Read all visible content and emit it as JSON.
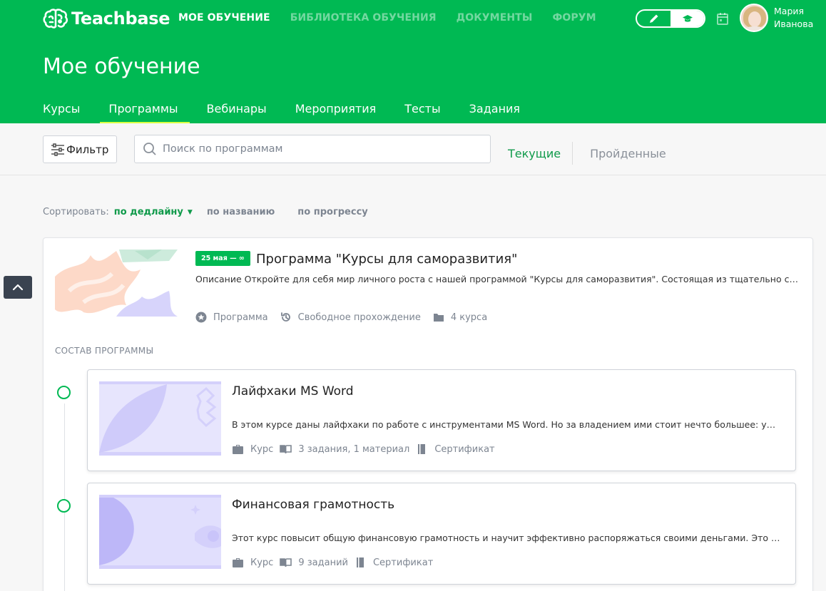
{
  "brand": {
    "name": "Teachbase",
    "accent": "#00b953",
    "highlight": "#d9ff43"
  },
  "topnav": [
    {
      "label": "МОЕ ОБУЧЕНИЕ",
      "active": true
    },
    {
      "label": "БИБЛИОТЕКА ОБУЧЕНИЯ",
      "active": false
    },
    {
      "label": "ДОКУМЕНТЫ",
      "active": false
    },
    {
      "label": "ФОРУМ",
      "active": false
    }
  ],
  "mode_toggle": {
    "icons": [
      "pencil-icon",
      "graduation-cap-icon"
    ],
    "active": "graduation-cap-icon"
  },
  "user": {
    "first_name": "Мария",
    "last_name": "Иванова"
  },
  "page_title": "Мое обучение",
  "subtabs": [
    {
      "label": "Курсы",
      "active": false
    },
    {
      "label": "Программы",
      "active": true
    },
    {
      "label": "Вебинары",
      "active": false
    },
    {
      "label": "Мероприятия",
      "active": false
    },
    {
      "label": "Тесты",
      "active": false
    },
    {
      "label": "Задания",
      "active": false
    }
  ],
  "toolbar": {
    "filter_label": "Фильтр",
    "search_placeholder": "Поиск по программам",
    "status_current": "Текущие",
    "status_done": "Пройденные"
  },
  "sort": {
    "label": "Сортировать:",
    "options": [
      "по дедлайну",
      "по названию",
      "по прогрессу"
    ],
    "active": "по дедлайну"
  },
  "program": {
    "deadline": "25 мая — ∞",
    "title": "Программа \"Курсы для саморазвития\"",
    "description": "Описание Откройте для себя мир личного роста с нашей программой \"Курсы для саморазвития\". Состоящая из тщательно спланированных курсов...",
    "meta": {
      "type": "Программа",
      "mode": "Свободное прохождение",
      "count": "4 курса"
    },
    "composition_label": "СОСТАВ ПРОГРАММЫ"
  },
  "courses": [
    {
      "title": "Лайфхаки MS Word",
      "description": "В этом курсе даны лайфхаки по работе с инструментами MS Word. Но за владением ими стоит нечто большее: умение работать быстро и качественно",
      "type": "Курс",
      "content": "3 задания, 1 материал",
      "certificate": "Сертификат"
    },
    {
      "title": "Финансовая грамотность",
      "description": "Этот курс повысит общую финансовую грамотность и научит эффективно распоряжаться своими деньгами. Это необходимо каждому",
      "type": "Курс",
      "content": "9 заданий",
      "certificate": "Сертификат"
    }
  ]
}
